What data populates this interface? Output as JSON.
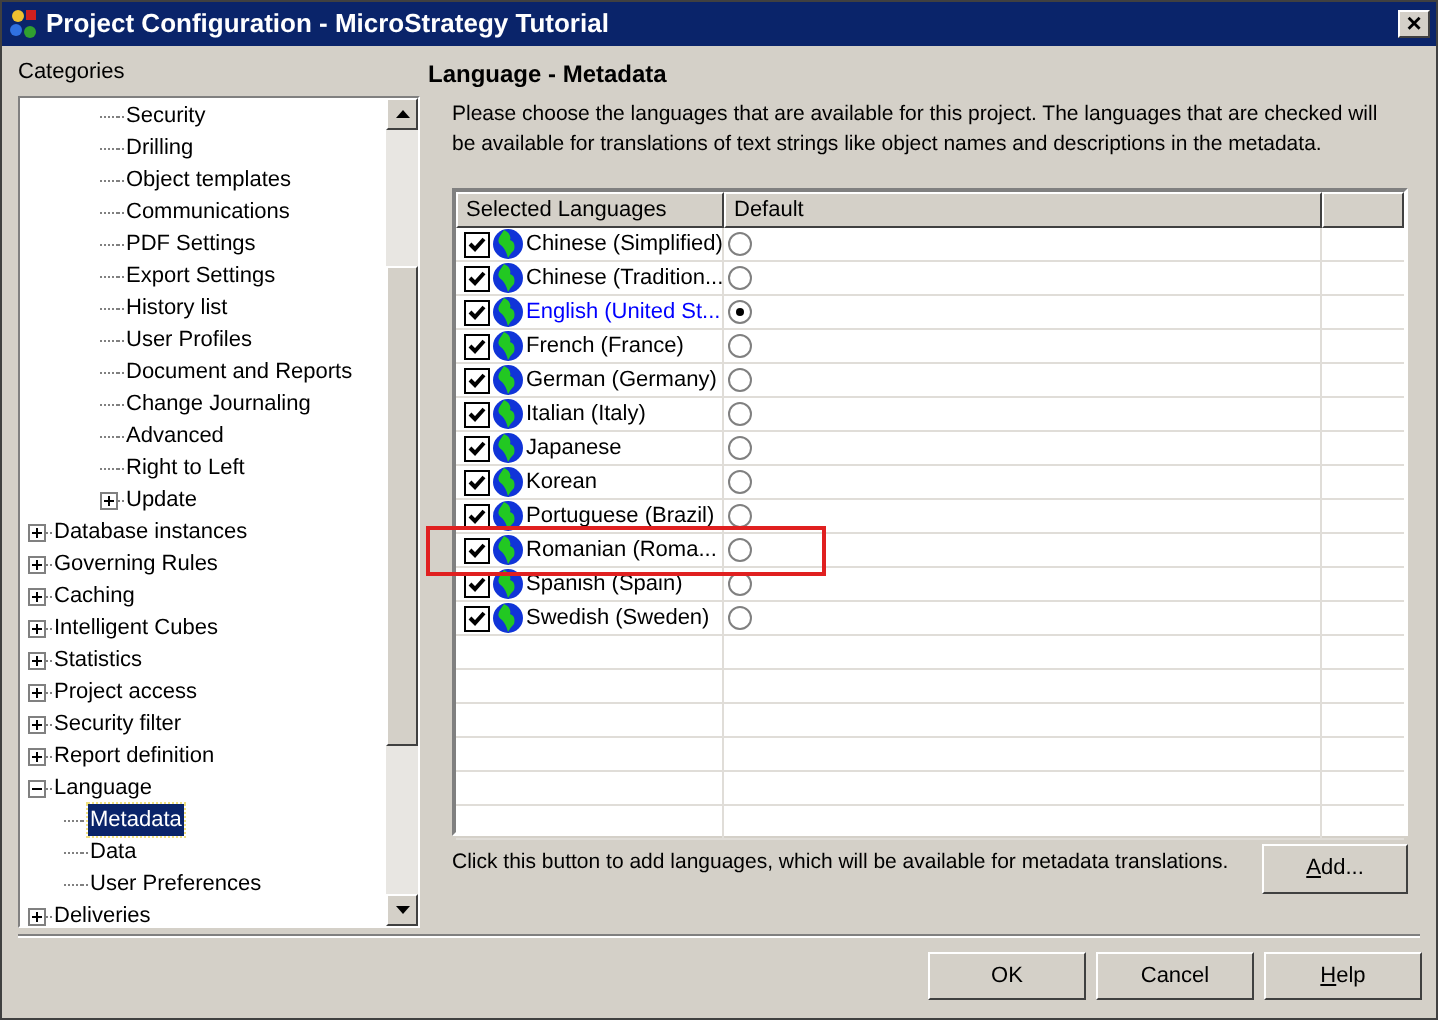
{
  "window": {
    "title": "Project Configuration - MicroStrategy Tutorial",
    "close": "×"
  },
  "categories": {
    "label": "Categories",
    "partial_branch": [
      {
        "label": "Security"
      },
      {
        "label": "Drilling"
      },
      {
        "label": "Object templates"
      },
      {
        "label": "Communications"
      },
      {
        "label": "PDF Settings"
      },
      {
        "label": "Export Settings"
      },
      {
        "label": "History list"
      },
      {
        "label": "User Profiles"
      },
      {
        "label": "Document and Reports"
      },
      {
        "label": "Change Journaling"
      },
      {
        "label": "Advanced"
      },
      {
        "label": "Right to Left"
      },
      {
        "label": "Update",
        "expanded": false
      }
    ],
    "items": [
      {
        "label": "Database instances",
        "expanded": false
      },
      {
        "label": "Governing Rules",
        "expanded": false
      },
      {
        "label": "Caching",
        "expanded": false
      },
      {
        "label": "Intelligent Cubes",
        "expanded": false
      },
      {
        "label": "Statistics",
        "expanded": false
      },
      {
        "label": "Project access",
        "expanded": false
      },
      {
        "label": "Security filter",
        "expanded": false
      },
      {
        "label": "Report definition",
        "expanded": false
      },
      {
        "label": "Language",
        "expanded": true,
        "children": [
          {
            "label": "Metadata",
            "selected": true
          },
          {
            "label": "Data",
            "selected": false
          },
          {
            "label": "User Preferences",
            "selected": false
          }
        ]
      },
      {
        "label": "Deliveries",
        "expanded": false
      }
    ]
  },
  "panel": {
    "title": "Language - Metadata",
    "description": "Please choose the languages that are available for this project. The languages that are checked will be available for translations of text strings like object names and descriptions in the metadata.",
    "table": {
      "columns": [
        "Selected Languages",
        "Default"
      ],
      "rows": [
        {
          "language": "Chinese (Simplified)",
          "checked": true,
          "default": false,
          "highlighted": false
        },
        {
          "language": "Chinese (Tradition...",
          "checked": true,
          "default": false,
          "highlighted": false
        },
        {
          "language": "English (United St...",
          "checked": true,
          "default": true,
          "highlighted": false
        },
        {
          "language": "French (France)",
          "checked": true,
          "default": false,
          "highlighted": false
        },
        {
          "language": "German (Germany)",
          "checked": true,
          "default": false,
          "highlighted": false
        },
        {
          "language": "Italian (Italy)",
          "checked": true,
          "default": false,
          "highlighted": false
        },
        {
          "language": "Japanese",
          "checked": true,
          "default": false,
          "highlighted": false
        },
        {
          "language": "Korean",
          "checked": true,
          "default": false,
          "highlighted": false
        },
        {
          "language": "Portuguese (Brazil)",
          "checked": true,
          "default": false,
          "highlighted": false
        },
        {
          "language": "Romanian (Roma...",
          "checked": true,
          "default": false,
          "highlighted": true
        },
        {
          "language": "Spanish (Spain)",
          "checked": true,
          "default": false,
          "highlighted": false
        },
        {
          "language": "Swedish (Sweden)",
          "checked": true,
          "default": false,
          "highlighted": false
        }
      ]
    },
    "add_hint": "Click this button to add languages, which will be available for metadata translations.",
    "add_button": {
      "label": "Add...",
      "underline_first": true
    }
  },
  "buttons": [
    {
      "label": "OK",
      "underline_first": false
    },
    {
      "label": "Cancel",
      "underline_first": false
    },
    {
      "label": "Help",
      "underline_first": true
    }
  ]
}
